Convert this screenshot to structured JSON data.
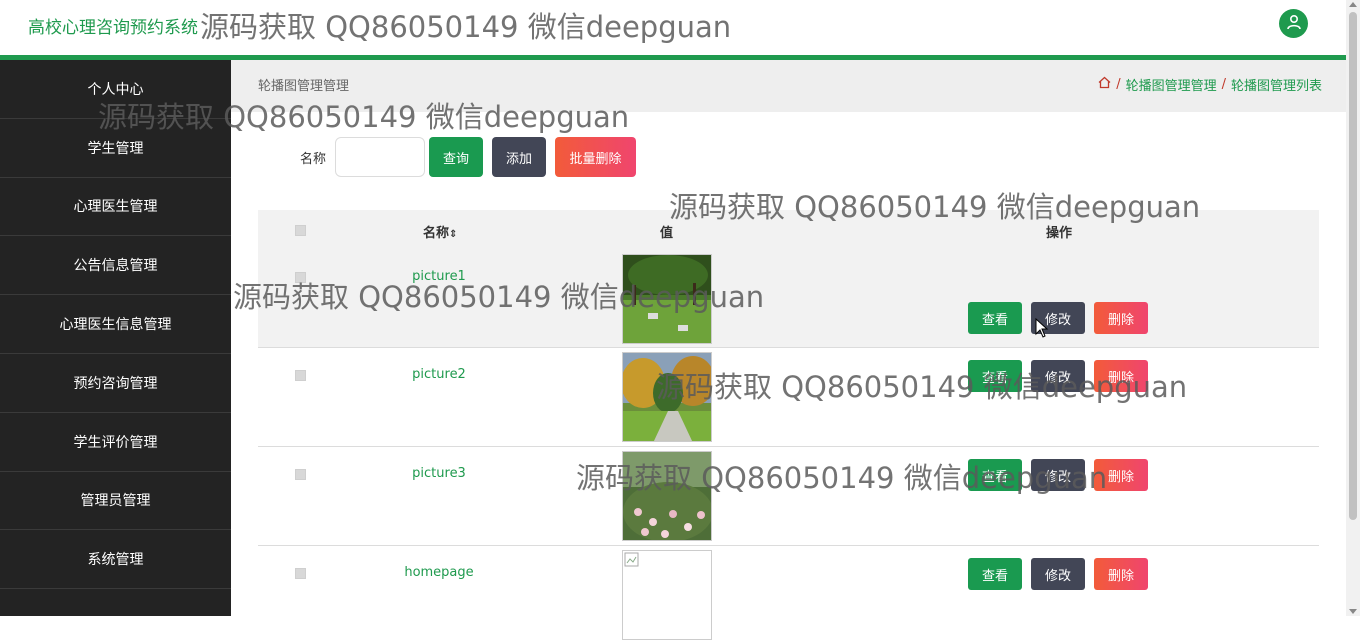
{
  "header": {
    "title": "高校心理咨询预约系统"
  },
  "watermark": "源码获取 QQ86050149 微信deepguan",
  "sidebar": {
    "items": [
      {
        "label": "个人中心"
      },
      {
        "label": "学生管理"
      },
      {
        "label": "心理医生管理"
      },
      {
        "label": "公告信息管理"
      },
      {
        "label": "心理医生信息管理"
      },
      {
        "label": "预约咨询管理"
      },
      {
        "label": "学生评价管理"
      },
      {
        "label": "管理员管理"
      },
      {
        "label": "系统管理"
      }
    ]
  },
  "breadcrumb": {
    "page_title": "轮播图管理管理",
    "path": [
      "轮播图管理管理",
      "轮播图管理列表"
    ],
    "separator": "/"
  },
  "search": {
    "label": "名称",
    "value": "",
    "search_button": "查询",
    "add_button": "添加",
    "batch_delete_button": "批量删除"
  },
  "table": {
    "columns": [
      "名称",
      "值",
      "操作"
    ],
    "sort_indicator": "⇕",
    "rows": [
      {
        "name": "picture1",
        "value_image": "park-lawn"
      },
      {
        "name": "picture2",
        "value_image": "autumn-trees"
      },
      {
        "name": "picture3",
        "value_image": "flower-bush"
      },
      {
        "name": "homepage",
        "value_image": "broken-image"
      }
    ],
    "actions": {
      "view": "查看",
      "edit": "修改",
      "delete": "删除"
    }
  },
  "colors": {
    "accent": "#1f9a4e",
    "sidebar_bg": "#232323",
    "dark_button": "#424656",
    "danger": "#f0456e"
  }
}
